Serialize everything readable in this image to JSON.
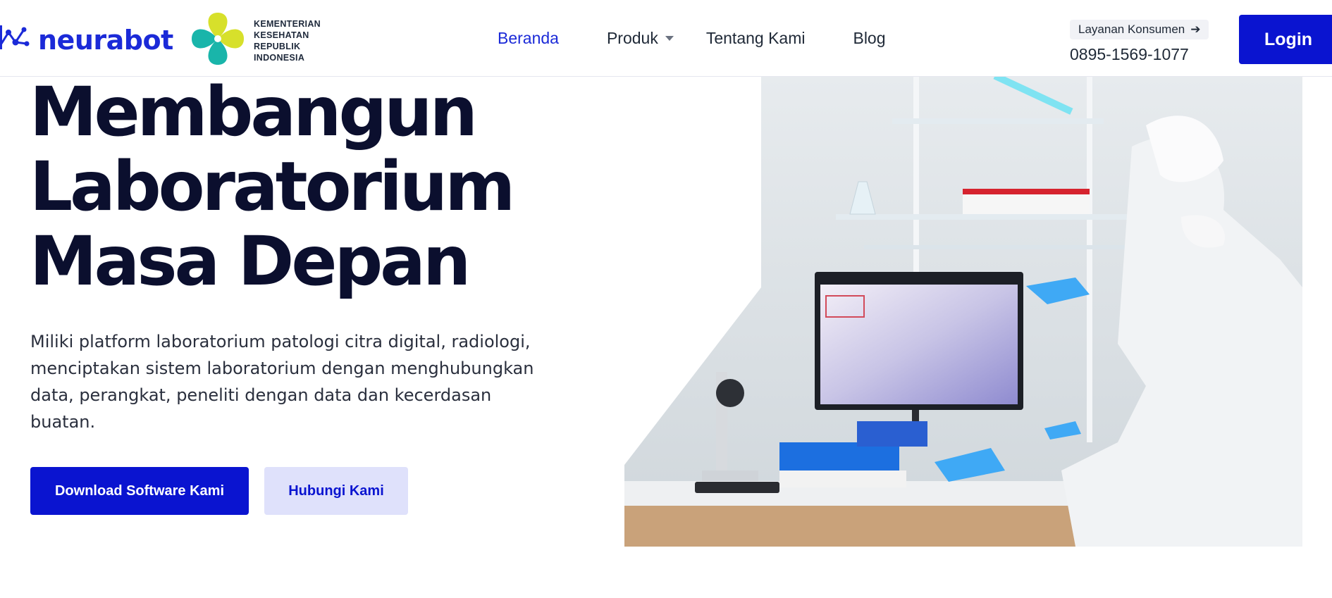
{
  "header": {
    "brand_name": "neurabot",
    "ministry_lines": [
      "KEMENTERIAN",
      "KESEHATAN",
      "REPUBLIK",
      "INDONESIA"
    ],
    "nav": [
      {
        "label": "Beranda",
        "active": true
      },
      {
        "label": "Produk",
        "has_dropdown": true
      },
      {
        "label": "Tentang Kami"
      },
      {
        "label": "Blog"
      }
    ],
    "customer_service_label": "Layanan Konsumen",
    "phone": "0895-1569-1077",
    "login_label": "Login"
  },
  "hero": {
    "title_lines": [
      "Membangun",
      "Laboratorium",
      "Masa Depan"
    ],
    "description": "Miliki platform laboratorium patologi citra digital, radiologi, menciptakan sistem laboratorium dengan menghubungkan data, perangkat, peneliti dengan data dan kecerdasan buatan.",
    "primary_cta": "Download Software Kami",
    "secondary_cta": "Hubungi Kami"
  },
  "colors": {
    "brand_blue": "#0a14d0",
    "nav_active": "#1b2ad8",
    "secondary_btn_bg": "#dfe1fb",
    "title_text": "#0b0f2e",
    "ministry_teal": "#19b5aa",
    "ministry_yellow": "#d7e02b"
  },
  "icons": {
    "brand": "neural-network-icon",
    "ministry": "ministry-leaf-logo",
    "dropdown": "chevron-down-icon",
    "arrow": "arrow-right-icon"
  }
}
